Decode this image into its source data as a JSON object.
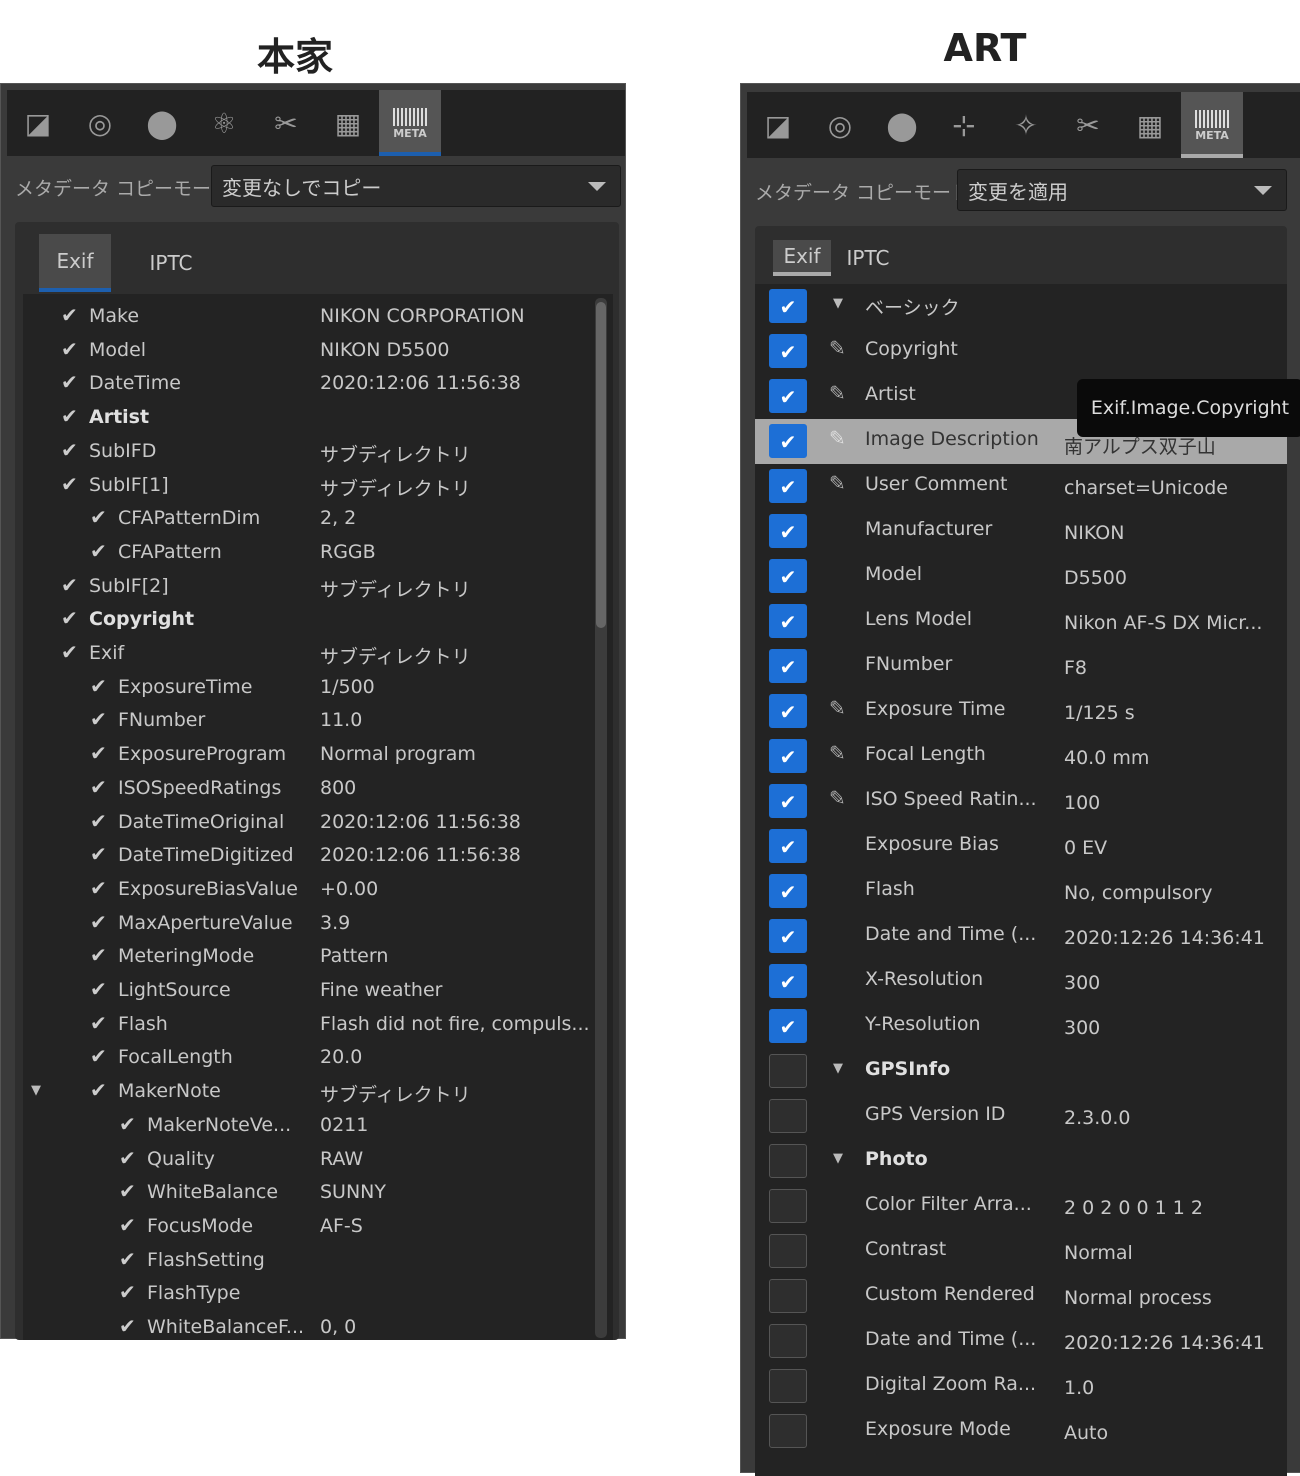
{
  "captions": {
    "left": "本家",
    "right": "ART"
  },
  "colors": {
    "accent_blue": "#1d5fae",
    "check_blue": "#1d6fd6"
  },
  "left": {
    "toolbar": [
      "exposure-icon",
      "detail-icon",
      "color-icon",
      "advanced-icon",
      "transform-icon",
      "raw-icon",
      "META"
    ],
    "mode_label": "メタデータ コピーモード:",
    "mode_value": "変更なしでコピー",
    "tabs": [
      "Exif",
      "IPTC"
    ],
    "rows": [
      {
        "l": 0,
        "k": "Make",
        "v": "NIKON CORPORATION"
      },
      {
        "l": 0,
        "k": "Model",
        "v": "NIKON D5500"
      },
      {
        "l": 0,
        "k": "DateTime",
        "v": "2020:12:06 11:56:38"
      },
      {
        "l": 0,
        "k": "Artist",
        "v": "",
        "b": true
      },
      {
        "l": 0,
        "k": "SubIFD",
        "v": "サブディレクトリ"
      },
      {
        "l": 0,
        "k": "SubIF[1]",
        "v": "サブディレクトリ",
        "e": true
      },
      {
        "l": 1,
        "k": "CFAPatternDim",
        "v": "2, 2"
      },
      {
        "l": 1,
        "k": "CFAPattern",
        "v": "RGGB"
      },
      {
        "l": 0,
        "k": "SubIF[2]",
        "v": "サブディレクトリ"
      },
      {
        "l": 0,
        "k": "Copyright",
        "v": "",
        "b": true
      },
      {
        "l": 0,
        "k": "Exif",
        "v": "サブディレクトリ",
        "e": true
      },
      {
        "l": 1,
        "k": "ExposureTime",
        "v": "1/500"
      },
      {
        "l": 1,
        "k": "FNumber",
        "v": "11.0"
      },
      {
        "l": 1,
        "k": "ExposureProgram",
        "v": "Normal program"
      },
      {
        "l": 1,
        "k": "ISOSpeedRatings",
        "v": "800"
      },
      {
        "l": 1,
        "k": "DateTimeOriginal",
        "v": "2020:12:06 11:56:38"
      },
      {
        "l": 1,
        "k": "DateTimeDigitized",
        "v": "2020:12:06 11:56:38"
      },
      {
        "l": 1,
        "k": "ExposureBiasValue",
        "v": "+0.00"
      },
      {
        "l": 1,
        "k": "MaxApertureValue",
        "v": "3.9"
      },
      {
        "l": 1,
        "k": "MeteringMode",
        "v": "Pattern"
      },
      {
        "l": 1,
        "k": "LightSource",
        "v": "Fine weather"
      },
      {
        "l": 1,
        "k": "Flash",
        "v": "Flash did not fire, compuls..."
      },
      {
        "l": 1,
        "k": "FocalLength",
        "v": "20.0"
      },
      {
        "l": 1,
        "k": "MakerNote",
        "v": "サブディレクトリ",
        "e": true
      },
      {
        "l": 2,
        "k": "MakerNoteVe...",
        "v": "0211"
      },
      {
        "l": 2,
        "k": "Quality",
        "v": "RAW"
      },
      {
        "l": 2,
        "k": "WhiteBalance",
        "v": "SUNNY"
      },
      {
        "l": 2,
        "k": "FocusMode",
        "v": "AF-S"
      },
      {
        "l": 2,
        "k": "FlashSetting",
        "v": ""
      },
      {
        "l": 2,
        "k": "FlashType",
        "v": ""
      },
      {
        "l": 2,
        "k": "WhiteBalanceF...",
        "v": "0, 0"
      }
    ]
  },
  "right": {
    "toolbar": [
      "exposure-icon",
      "detail-icon",
      "color-icon",
      "local-adjust-icon",
      "effects-icon",
      "transform-icon",
      "raw-icon",
      "META"
    ],
    "mode_label": "メタデータ コピーモード:",
    "mode_value": "変更を適用",
    "tabs": [
      "Exif",
      "IPTC"
    ],
    "tooltip": "Exif.Image.Copyright",
    "rows": [
      {
        "c": true,
        "s": true,
        "k": "ベーシック",
        "v": ""
      },
      {
        "c": true,
        "p": true,
        "k": "Copyright",
        "v": ""
      },
      {
        "c": true,
        "p": true,
        "k": "Artist",
        "v": ""
      },
      {
        "c": true,
        "p": true,
        "k": "Image Description",
        "v": "南アルプス双子山",
        "h": true
      },
      {
        "c": true,
        "p": true,
        "k": "User Comment",
        "v": "charset=Unicode"
      },
      {
        "c": true,
        "k": "Manufacturer",
        "v": "NIKON"
      },
      {
        "c": true,
        "k": "Model",
        "v": "D5500"
      },
      {
        "c": true,
        "k": "Lens Model",
        "v": "Nikon AF-S DX Micr..."
      },
      {
        "c": true,
        "k": "FNumber",
        "v": "F8"
      },
      {
        "c": true,
        "p": true,
        "k": "Exposure Time",
        "v": "1/125 s"
      },
      {
        "c": true,
        "p": true,
        "k": "Focal Length",
        "v": "40.0 mm"
      },
      {
        "c": true,
        "p": true,
        "k": "ISO Speed Ratin...",
        "v": "100"
      },
      {
        "c": true,
        "k": "Exposure Bias",
        "v": "0 EV"
      },
      {
        "c": true,
        "k": "Flash",
        "v": "No, compulsory"
      },
      {
        "c": true,
        "k": "Date and Time (...",
        "v": "2020:12:26 14:36:41"
      },
      {
        "c": true,
        "k": "X-Resolution",
        "v": "300"
      },
      {
        "c": true,
        "k": "Y-Resolution",
        "v": "300"
      },
      {
        "c": false,
        "s": true,
        "k": "GPSInfo",
        "v": ""
      },
      {
        "c": false,
        "k": "GPS Version ID",
        "v": "2.3.0.0"
      },
      {
        "c": false,
        "s": true,
        "k": "Photo",
        "v": ""
      },
      {
        "c": false,
        "k": "Color Filter Arra...",
        "v": "2 0 2 0 0 1 1 2"
      },
      {
        "c": false,
        "k": "Contrast",
        "v": "Normal"
      },
      {
        "c": false,
        "k": "Custom Rendered",
        "v": "Normal process"
      },
      {
        "c": false,
        "k": "Date and Time (...",
        "v": "2020:12:26 14:36:41"
      },
      {
        "c": false,
        "k": "Digital Zoom Ra...",
        "v": "1.0"
      },
      {
        "c": false,
        "k": "Exposure Mode",
        "v": "Auto"
      }
    ]
  }
}
